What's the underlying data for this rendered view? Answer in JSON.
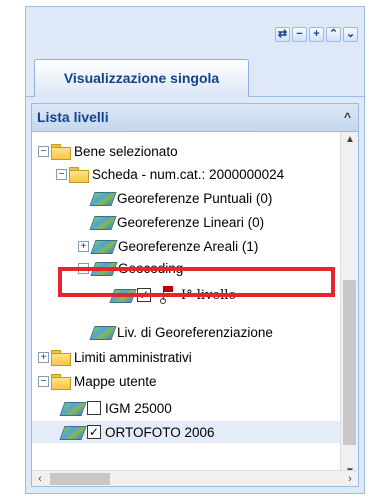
{
  "toolbar": {
    "icons": [
      "refresh-icon",
      "minus-icon",
      "plus-icon",
      "collapse-up-icon",
      "collapse-down-icon"
    ]
  },
  "tabs": [
    {
      "label": "Visualizzazione singola",
      "active": true
    }
  ],
  "layer_panel": {
    "title": "Lista livelli",
    "tree": [
      {
        "label": "Bene selezionato",
        "type": "folder",
        "expanded": true
      },
      {
        "label": "Scheda - num.cat.: 2000000024",
        "type": "folder",
        "expanded": true
      },
      {
        "label": "Georeferenze Puntuali (0)",
        "type": "layer"
      },
      {
        "label": "Georeferenze Lineari (0)",
        "type": "layer"
      },
      {
        "label": "Georeferenze Areali (1)",
        "type": "layer",
        "highlighted": true
      },
      {
        "label": "Geocoding",
        "type": "layer",
        "expanded": true
      },
      {
        "label": "I° livello",
        "type": "layer",
        "checked": true
      },
      {
        "label": "Liv. di Georeferenziazione",
        "type": "layer"
      },
      {
        "label": "Limiti amministrativi",
        "type": "folder",
        "expanded": false
      },
      {
        "label": "Mappe utente",
        "type": "folder",
        "expanded": true
      },
      {
        "label": "IGM 25000",
        "type": "layer",
        "checked": false
      },
      {
        "label": "ORTOFOTO 2006",
        "type": "layer",
        "checked": true,
        "selected": true
      }
    ]
  },
  "colors": {
    "panel_border": "#99bbe8",
    "header_text": "#15428b",
    "highlight": "#e3262f",
    "selection": "#e3ecf8"
  }
}
